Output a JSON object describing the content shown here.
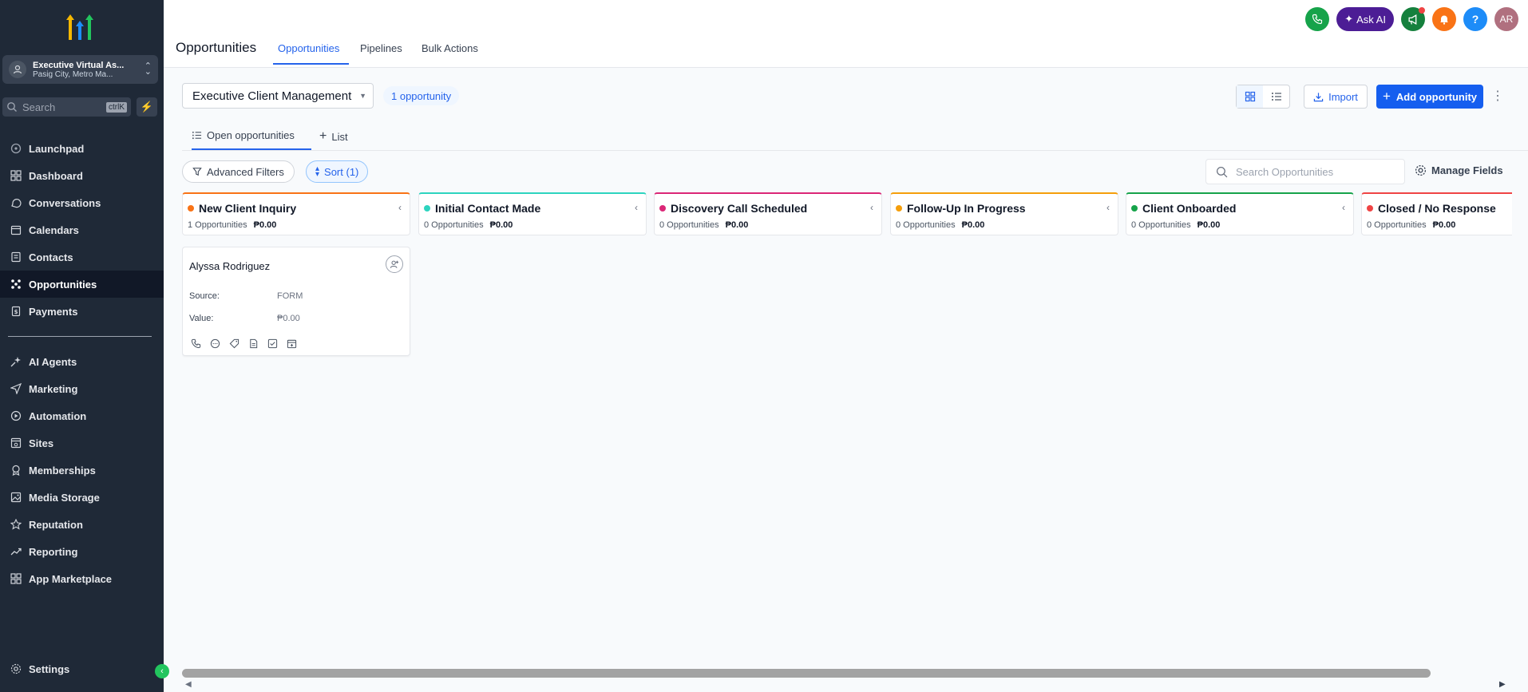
{
  "sidebar": {
    "account": {
      "name": "Executive Virtual As...",
      "location": "Pasig City, Metro Ma..."
    },
    "search": {
      "placeholder": "Search",
      "shortcut": "ctrlK"
    },
    "nav_primary": [
      {
        "label": "Launchpad",
        "icon": "rocket-icon"
      },
      {
        "label": "Dashboard",
        "icon": "grid-icon"
      },
      {
        "label": "Conversations",
        "icon": "chat-icon"
      },
      {
        "label": "Calendars",
        "icon": "calendar-icon"
      },
      {
        "label": "Contacts",
        "icon": "contacts-icon"
      },
      {
        "label": "Opportunities",
        "icon": "opportunities-icon",
        "active": true
      },
      {
        "label": "Payments",
        "icon": "payments-icon"
      }
    ],
    "nav_secondary": [
      {
        "label": "AI Agents",
        "icon": "sparkle-icon"
      },
      {
        "label": "Marketing",
        "icon": "send-icon"
      },
      {
        "label": "Automation",
        "icon": "automation-icon"
      },
      {
        "label": "Sites",
        "icon": "sites-icon"
      },
      {
        "label": "Memberships",
        "icon": "award-icon"
      },
      {
        "label": "Media Storage",
        "icon": "image-icon"
      },
      {
        "label": "Reputation",
        "icon": "star-icon"
      },
      {
        "label": "Reporting",
        "icon": "trend-icon"
      },
      {
        "label": "App Marketplace",
        "icon": "apps-icon"
      }
    ],
    "settings_label": "Settings"
  },
  "header": {
    "title": "Opportunities",
    "tabs": [
      {
        "label": "Opportunities",
        "active": true
      },
      {
        "label": "Pipelines"
      },
      {
        "label": "Bulk Actions"
      }
    ],
    "ask_ai_label": "Ask AI",
    "user_initials": "AR",
    "help_label": "?"
  },
  "toolbar": {
    "pipeline_name": "Executive Client Management",
    "count_label": "1 opportunity",
    "import_label": "Import",
    "add_label": "Add opportunity"
  },
  "view_tabs": {
    "open_label": "Open opportunities",
    "list_label": "List"
  },
  "filters": {
    "advanced_label": "Advanced Filters",
    "sort_label": "Sort (1)",
    "search_placeholder": "Search Opportunities",
    "manage_fields_label": "Manage Fields"
  },
  "stages": [
    {
      "name": "New Client Inquiry",
      "count": "1 Opportunities",
      "value": "₱0.00",
      "color": "#f97316"
    },
    {
      "name": "Initial Contact Made",
      "count": "0 Opportunities",
      "value": "₱0.00",
      "color": "#2dd4bf"
    },
    {
      "name": "Discovery Call Scheduled",
      "count": "0 Opportunities",
      "value": "₱0.00",
      "color": "#db2777"
    },
    {
      "name": "Follow-Up In Progress",
      "count": "0 Opportunities",
      "value": "₱0.00",
      "color": "#f59e0b"
    },
    {
      "name": "Client Onboarded",
      "count": "0 Opportunities",
      "value": "₱0.00",
      "color": "#16a34a"
    },
    {
      "name": "Closed / No Response",
      "count": "0 Opportunities",
      "value": "₱0.00",
      "color": "#ef4444"
    }
  ],
  "card": {
    "name": "Alyssa Rodriguez",
    "source_label": "Source:",
    "source_value": "FORM",
    "value_label": "Value:",
    "value_value": "₱0.00"
  }
}
